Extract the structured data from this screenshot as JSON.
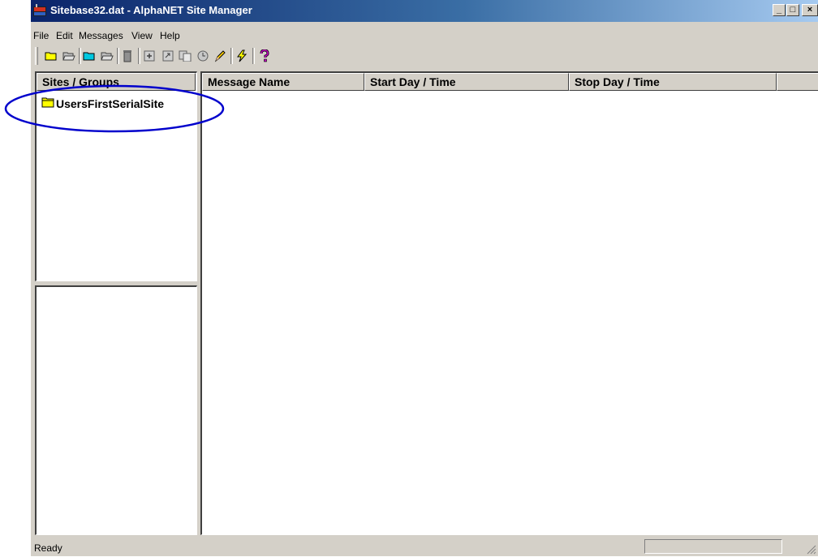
{
  "window": {
    "title": "Sitebase32.dat - AlphaNET Site Manager"
  },
  "menu": {
    "items": [
      "File",
      "Edit",
      "Messages",
      "View",
      "Help"
    ]
  },
  "toolbar": {
    "icons": [
      "new-folder-icon",
      "open-folder-icon",
      "new-site-icon",
      "open-site-icon",
      "delete-icon",
      "add-message-icon",
      "message-properties-icon",
      "copy-message-icon",
      "schedule-icon",
      "edit-pencil-icon",
      "send-lightning-icon",
      "help-icon"
    ]
  },
  "sites_panel": {
    "header": "Sites / Groups",
    "items": [
      "UsersFirstSerialSite"
    ]
  },
  "messages_panel": {
    "columns": [
      "Message Name",
      "Start Day / Time",
      "Stop Day / Time"
    ]
  },
  "statusbar": {
    "text": "Ready"
  },
  "annotation": {
    "color": "#0000cc"
  },
  "colors": {
    "folder": "#ffff00",
    "title_start": "#0a246a",
    "title_end": "#a6caf0"
  }
}
